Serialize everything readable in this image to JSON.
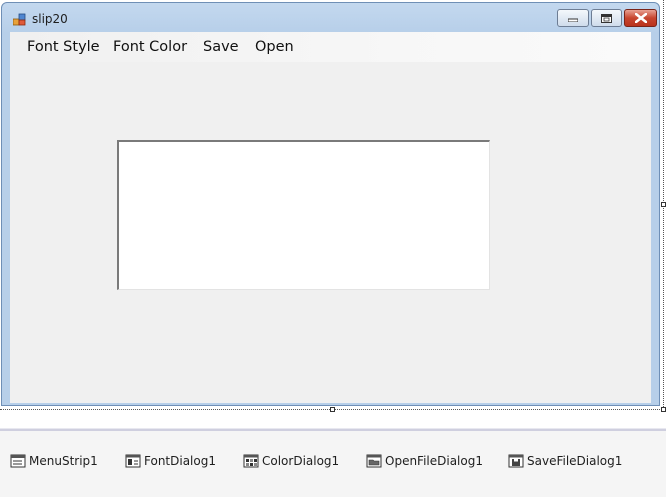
{
  "form": {
    "title": "slip20",
    "window_buttons": {
      "minimize_icon": "minimize-icon",
      "maximize_icon": "maximize-icon",
      "close_icon": "close-icon"
    }
  },
  "menu": {
    "items": [
      {
        "label": "Font Style"
      },
      {
        "label": "Font Color"
      },
      {
        "label": "Save"
      },
      {
        "label": "Open"
      }
    ]
  },
  "rich_text_box": {
    "value": ""
  },
  "component_tray": {
    "items": [
      {
        "label": "MenuStrip1",
        "icon": "menustrip-icon"
      },
      {
        "label": "FontDialog1",
        "icon": "fontdialog-icon"
      },
      {
        "label": "ColorDialog1",
        "icon": "colordialog-icon"
      },
      {
        "label": "OpenFileDialog1",
        "icon": "openfiledialog-icon"
      },
      {
        "label": "SaveFileDialog1",
        "icon": "savefiledialog-icon"
      }
    ]
  },
  "colors": {
    "title_bar": "#b7cfe9",
    "client_background": "#f0f0f0",
    "close_button": "#c7452f",
    "tray_background": "#f5f5f5"
  }
}
